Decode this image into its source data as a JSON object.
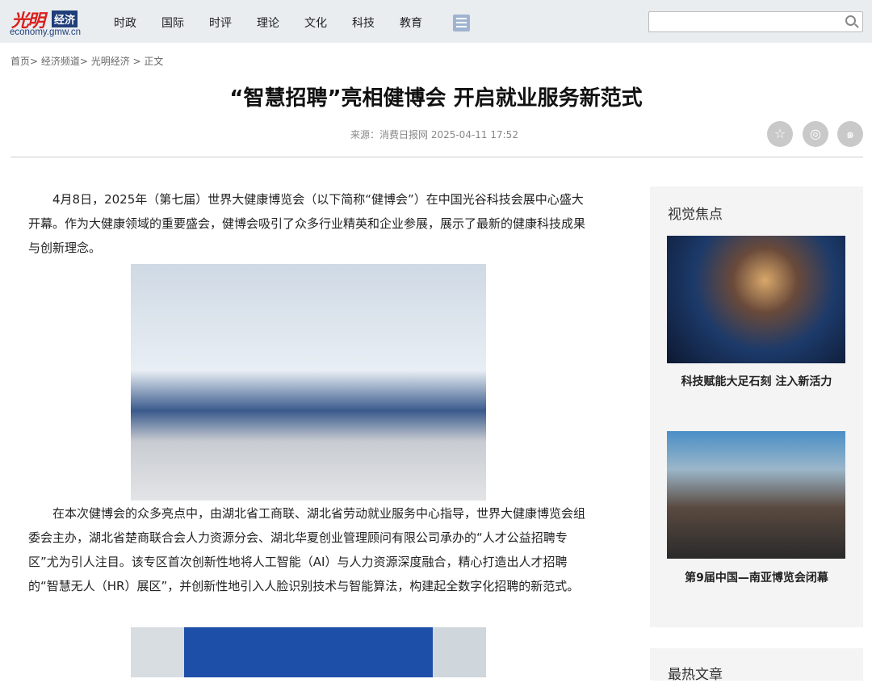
{
  "header": {
    "logo_brand": "光明",
    "logo_tag": "经济",
    "logo_domain": "economy.gmw.cn",
    "nav": [
      "时政",
      "国际",
      "时评",
      "理论",
      "文化",
      "科技",
      "教育"
    ],
    "search_placeholder": ""
  },
  "breadcrumb": "首页> 经济频道> 光明经济 > 正文",
  "article": {
    "title": "“智慧招聘”亮相健博会 开启就业服务新范式",
    "meta": "来源：消费日报网   2025-04-11 17:52",
    "paragraphs": [
      "4月8日，2025年（第七届）世界大健康博览会（以下简称“健博会”）在中国光谷科技会展中心盛大开幕。作为大健康领域的重要盛会，健博会吸引了众多行业精英和企业参展，展示了最新的健康科技成果与创新理念。",
      "在本次健博会的众多亮点中，由湖北省工商联、湖北省劳动就业服务中心指导，世界大健康博览会组委会主办，湖北省楚商联合会人力资源分会、湖北华夏创业管理顾问有限公司承办的“人才公益招聘专区”尤为引人注目。该专区首次创新性地将人工智能（AI）与人力资源深度融合，精心打造出人才招聘的“智慧无人（HR）展区”，并创新性地引入人脸识别技术与智能算法，构建起全数字化招聘的新范式。"
    ]
  },
  "share": {
    "qzone": "star-icon",
    "wechat": "wechat-icon",
    "weibo": "weibo-icon"
  },
  "sidebar": {
    "focus_title": "视觉焦点",
    "items": [
      {
        "caption": "科技赋能大足石刻 注入新活力"
      },
      {
        "caption": "第9届中国—南亚博览会闭幕"
      }
    ],
    "hot_title": "最热文章"
  }
}
